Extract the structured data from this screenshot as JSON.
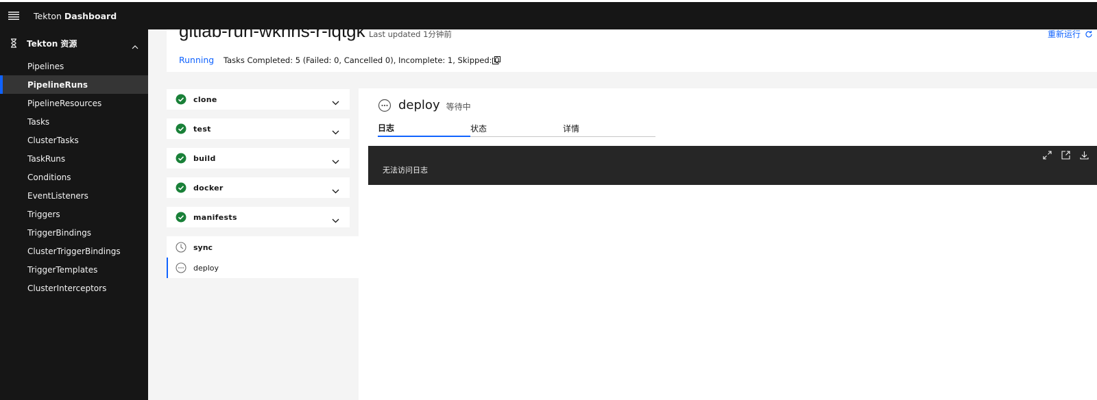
{
  "header": {
    "brand_prefix": "Tekton",
    "brand_name": "Dashboard"
  },
  "sidebar": {
    "group_label": "Tekton 资源",
    "items": [
      {
        "label": "Pipelines"
      },
      {
        "label": "PipelineRuns"
      },
      {
        "label": "PipelineResources"
      },
      {
        "label": "Tasks"
      },
      {
        "label": "ClusterTasks"
      },
      {
        "label": "TaskRuns"
      },
      {
        "label": "Conditions"
      },
      {
        "label": "EventListeners"
      },
      {
        "label": "Triggers"
      },
      {
        "label": "TriggerBindings"
      },
      {
        "label": "ClusterTriggerBindings"
      },
      {
        "label": "TriggerTemplates"
      },
      {
        "label": "ClusterInterceptors"
      }
    ],
    "active_index": 1
  },
  "run": {
    "name": "gitlab-run-wkhhs-r-lqtgk",
    "last_updated": "Last updated 1分钟前",
    "rerun_label": "重新运行",
    "status": "Running",
    "status_detail": "Tasks Completed: 5 (Failed: 0, Cancelled 0), Incomplete: 1, Skipped: 0"
  },
  "tasks": [
    {
      "label": "clone",
      "state": "succeeded"
    },
    {
      "label": "test",
      "state": "succeeded"
    },
    {
      "label": "build",
      "state": "succeeded"
    },
    {
      "label": "docker",
      "state": "succeeded"
    },
    {
      "label": "manifests",
      "state": "succeeded"
    }
  ],
  "current_task": {
    "label": "sync",
    "state": "pending",
    "steps": [
      {
        "label": "deploy",
        "state": "waiting"
      }
    ]
  },
  "detail": {
    "step_name": "deploy",
    "step_status": "等待中",
    "tabs": [
      {
        "label": "日志"
      },
      {
        "label": "状态"
      },
      {
        "label": "详情"
      }
    ],
    "active_tab": 0,
    "log_message": "无法访问日志"
  },
  "colors": {
    "accent": "#0f62fe",
    "success": "#198038",
    "header_bg": "#161616",
    "log_bg": "#262626"
  }
}
